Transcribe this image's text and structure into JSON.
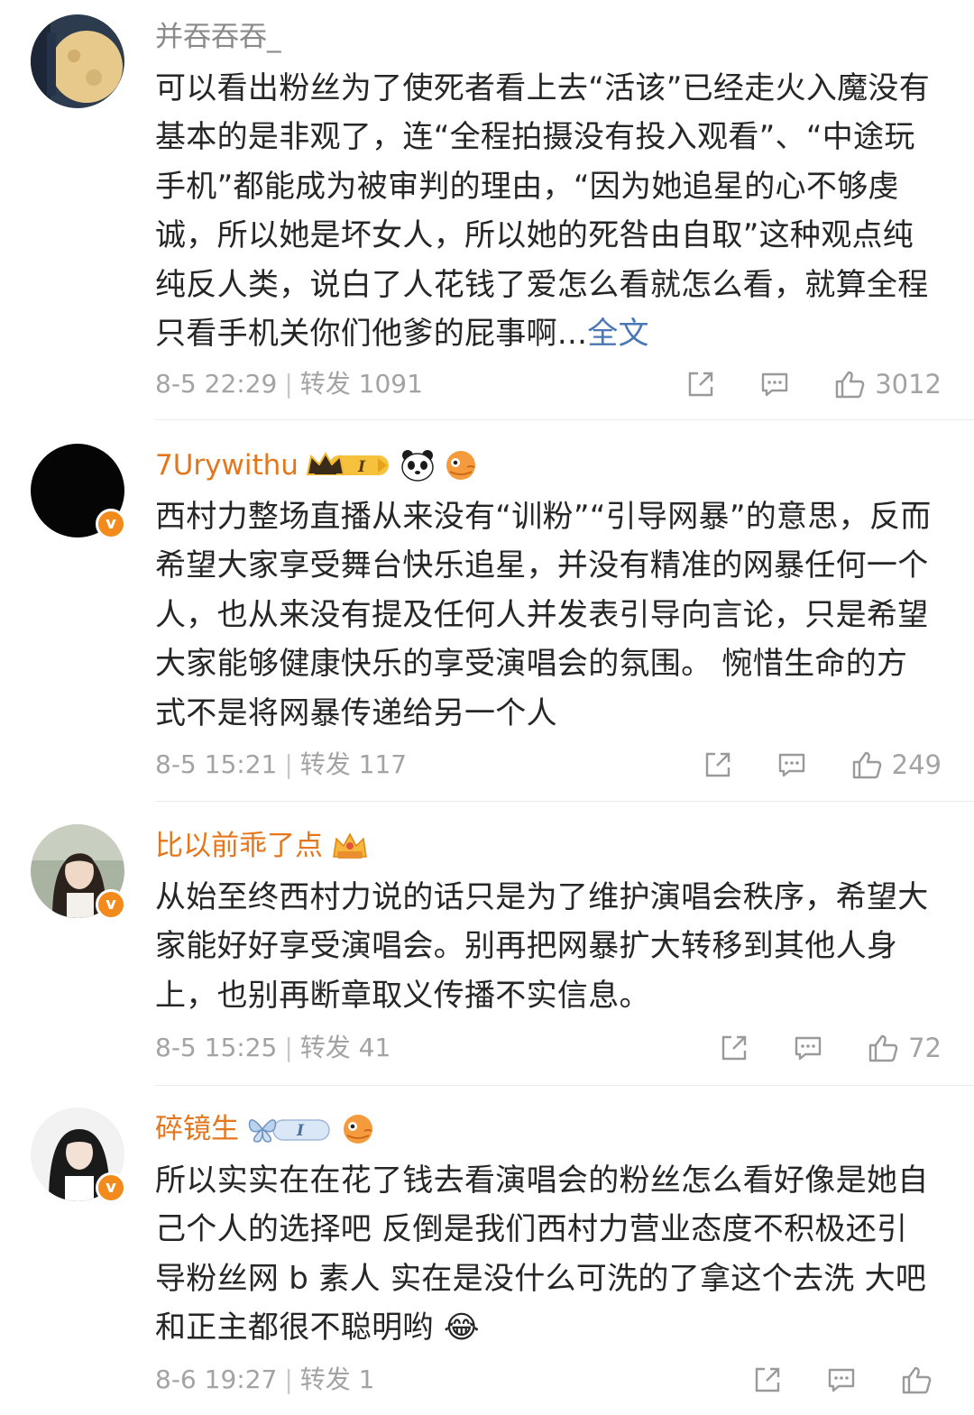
{
  "comments": [
    {
      "username": "并吞吞吞_",
      "verified": false,
      "content": "可以看出粉丝为了使死者看上去“活该”已经走火入魔没有基本的是非观了，连“全程拍摄没有投入观看”、“中途玩手机”都能成为被审判的理由，“因为她追星的心不够虔诚，所以她是坏女人，所以她的死咎由自取”这种观点纯纯反人类，说白了人花钱了爱怎么看就怎么看，就算全程只看手机关你们他爹的屁事啊...",
      "more_label": "全文",
      "time": "8-5 22:29",
      "forward_label": "转发 1091",
      "likes": "3012",
      "icons": [
        "share-icon",
        "comment-icon",
        "like-icon"
      ]
    },
    {
      "username": "7Urywithu",
      "verified": true,
      "verified_mark": "v",
      "badges": [
        "crown-level-badge",
        "panda-badge",
        "fish-badge"
      ],
      "badge_text": "I",
      "content": "西村力整场直播从来没有“训粉”“引导网暴”的意思，反而希望大家享受舞台快乐追星，并没有精准的网暴任何一个人，也从来没有提及任何人并发表引导向言论，只是希望大家能够健康快乐的享受演唱会的氛围。 惋惜生命的方式不是将网暴传递给另一个人",
      "time": "8-5 15:21",
      "forward_label": "转发 117",
      "likes": "249"
    },
    {
      "username": "比以前乖了点",
      "verified": true,
      "verified_mark": "v",
      "badges": [
        "crown-badge"
      ],
      "content": "从始至终西村力说的话只是为了维护演唱会秩序，希望大家能好好享受演唱会。别再把网暴扩大转移到其他人身上，也别再断章取义传播不实信息。",
      "time": "8-5 15:25",
      "forward_label": "转发 41",
      "likes": "72"
    },
    {
      "username": "碎镜生",
      "verified": true,
      "verified_mark": "v",
      "badges": [
        "butterfly-level-badge",
        "fish-badge"
      ],
      "badge_text": "I",
      "content": "所以实实在在花了钱去看演唱会的粉丝怎么看好像是她自己个人的选择吧 反倒是我们西村力营业态度不积极还引导粉丝网 b 素人 实在是没什么可洗的了拿这个去洗 大吧和正主都很不聪明哟",
      "emoji": "😂",
      "time": "8-6 19:27",
      "forward_label": "转发 1",
      "likes": ""
    }
  ]
}
